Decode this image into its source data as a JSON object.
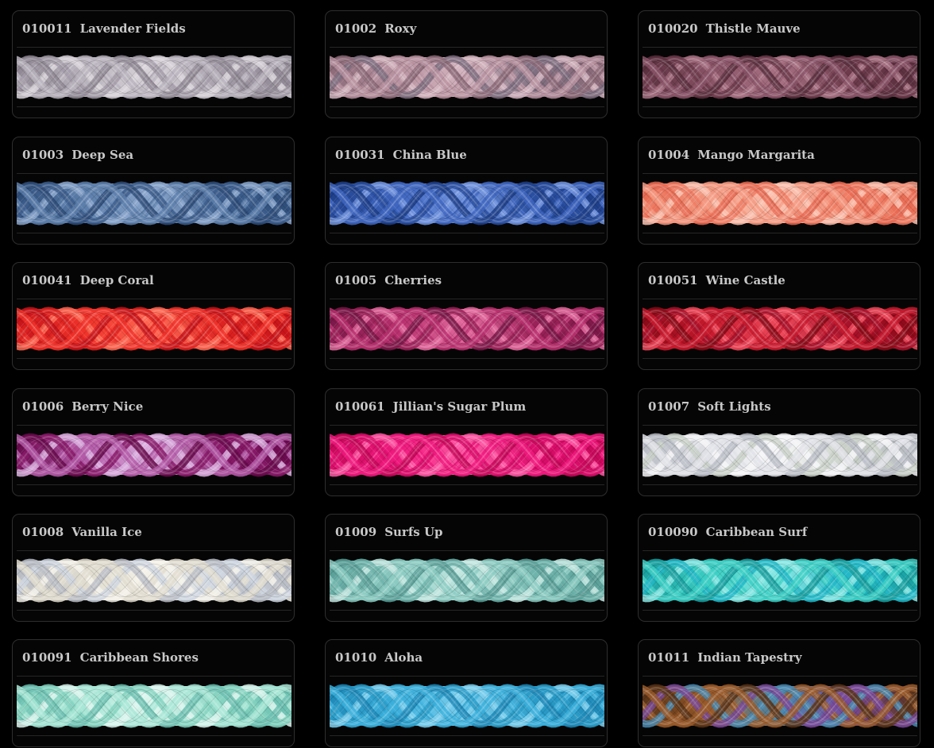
{
  "threads": [
    {
      "code": "010011",
      "name": "Lavender Fields",
      "icon": "thread-skein-icon",
      "colors": [
        "#8f8894",
        "#b9b3bd",
        "#d9d3da",
        "#a39ca8"
      ]
    },
    {
      "code": "01002",
      "name": "Roxy",
      "icon": "thread-skein-icon",
      "colors": [
        "#8c6a78",
        "#b892a0",
        "#d4b5c0",
        "#7f6f80"
      ]
    },
    {
      "code": "010020",
      "name": "Thistle Mauve",
      "icon": "thread-skein-icon",
      "colors": [
        "#5a2f3e",
        "#8a5467",
        "#a87284",
        "#6d3b4c"
      ]
    },
    {
      "code": "01003",
      "name": "Deep Sea",
      "icon": "thread-skein-icon",
      "colors": [
        "#2f4e7a",
        "#5d7fab",
        "#8aa6cc",
        "#3d5e8d"
      ]
    },
    {
      "code": "010031",
      "name": "China Blue",
      "icon": "thread-skein-icon",
      "colors": [
        "#1f3f8a",
        "#3f66c0",
        "#7496e0",
        "#2a4fa0"
      ]
    },
    {
      "code": "01004",
      "name": "Mango Margarita",
      "icon": "thread-skein-icon",
      "colors": [
        "#e86a52",
        "#f49a82",
        "#fbc2b0",
        "#f07d64"
      ]
    },
    {
      "code": "010041",
      "name": "Deep Coral",
      "icon": "thread-skein-icon",
      "colors": [
        "#c8141a",
        "#f0332a",
        "#ff6a55",
        "#dd2220"
      ]
    },
    {
      "code": "01005",
      "name": "Cherries",
      "icon": "thread-skein-icon",
      "colors": [
        "#7a1848",
        "#b8306e",
        "#e36a9e",
        "#9a2258"
      ]
    },
    {
      "code": "010051",
      "name": "Wine Castle",
      "icon": "thread-skein-icon",
      "colors": [
        "#8a0a18",
        "#c81a2e",
        "#ee4a5c",
        "#a8122a"
      ]
    },
    {
      "code": "01006",
      "name": "Berry Nice",
      "icon": "thread-skein-icon",
      "colors": [
        "#6a0a4e",
        "#b45aa8",
        "#dcb0e0",
        "#8a1a6a"
      ]
    },
    {
      "code": "010061",
      "name": "Jillian's Sugar Plum",
      "icon": "thread-skein-icon",
      "colors": [
        "#c8085a",
        "#f01a7e",
        "#ff5aa6",
        "#dc0e6c"
      ]
    },
    {
      "code": "01007",
      "name": "Soft Lights",
      "icon": "thread-skein-icon",
      "colors": [
        "#b9bcc4",
        "#e0e2e8",
        "#f6f6f8",
        "#c9d0c8"
      ]
    },
    {
      "code": "01008",
      "name": "Vanilla Ice",
      "icon": "thread-skein-icon",
      "colors": [
        "#b8bcc4",
        "#e0dccf",
        "#f4f2ea",
        "#cfd6e0"
      ]
    },
    {
      "code": "01009",
      "name": "Surfs Up",
      "icon": "thread-skein-icon",
      "colors": [
        "#5a9f98",
        "#8ccbc2",
        "#c4e8e2",
        "#6eb4ac"
      ]
    },
    {
      "code": "010090",
      "name": "Caribbean Surf",
      "icon": "thread-skein-icon",
      "colors": [
        "#1aa0a0",
        "#3ccfc4",
        "#8ae8e4",
        "#22b8c8"
      ]
    },
    {
      "code": "010091",
      "name": "Caribbean Shores",
      "icon": "thread-skein-icon",
      "colors": [
        "#6cc0b0",
        "#a8e6d6",
        "#dcf6ee",
        "#84d2c0"
      ]
    },
    {
      "code": "01010",
      "name": "Aloha",
      "icon": "thread-skein-icon",
      "colors": [
        "#1f8ab8",
        "#3cb0dc",
        "#7ed0ee",
        "#2a9cc8"
      ]
    },
    {
      "code": "01011",
      "name": "Indian Tapestry",
      "icon": "thread-skein-icon",
      "colors": [
        "#5a3418",
        "#9a5a2a",
        "#4a8ab0",
        "#7a4a9a"
      ]
    }
  ]
}
